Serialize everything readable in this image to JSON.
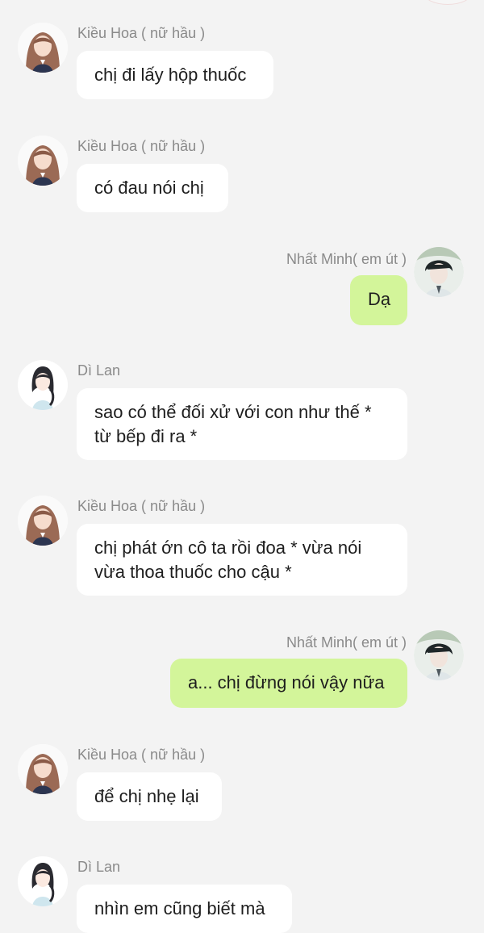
{
  "colors": {
    "background": "#f3f3f3",
    "bubble_left": "#ffffff",
    "bubble_right": "#d3f59a",
    "name_text": "#8a8a8a",
    "message_text": "#1e1e1e"
  },
  "messages": [
    {
      "side": "left",
      "avatar": "kieu-hoa-avatar",
      "sender": "Kiều Hoa ( nữ hầu )",
      "text": "chị đi lấy hộp thuốc"
    },
    {
      "side": "left",
      "avatar": "kieu-hoa-avatar",
      "sender": "Kiều Hoa ( nữ hầu )",
      "text": "có đau nói chị"
    },
    {
      "side": "right",
      "avatar": "nhat-minh-avatar",
      "sender": "Nhất Minh( em út )",
      "text": "Dạ"
    },
    {
      "side": "left",
      "avatar": "di-lan-avatar",
      "sender": "Dì Lan",
      "text": "sao có thể đối xử với con như thế * từ bếp đi ra *"
    },
    {
      "side": "left",
      "avatar": "kieu-hoa-avatar",
      "sender": "Kiều Hoa ( nữ hầu )",
      "text": "chị phát ớn cô ta rồi đoa * vừa nói vừa thoa thuốc cho cậu *"
    },
    {
      "side": "right",
      "avatar": "nhat-minh-avatar",
      "sender": "Nhất Minh( em út )",
      "text": "a... chị đừng nói vậy nữa"
    },
    {
      "side": "left",
      "avatar": "kieu-hoa-avatar",
      "sender": "Kiều Hoa ( nữ hầu )",
      "text": "để chị nhẹ lại"
    },
    {
      "side": "left",
      "avatar": "di-lan-avatar",
      "sender": "Dì Lan",
      "text": "nhìn em cũng biết mà"
    }
  ]
}
